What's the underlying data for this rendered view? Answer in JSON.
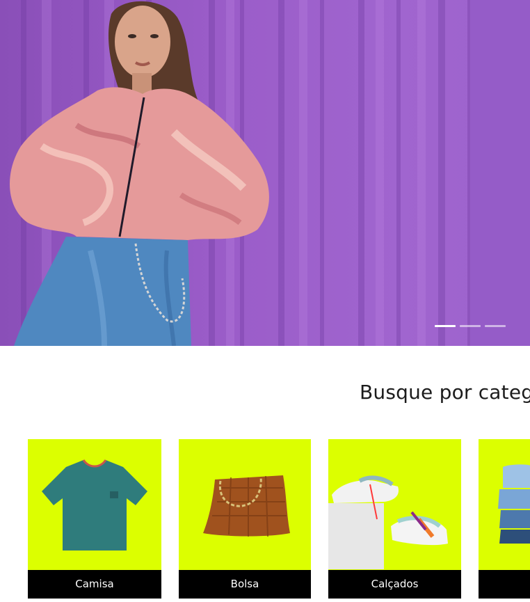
{
  "hero": {
    "slides_total": 3,
    "active_slide": 1
  },
  "section": {
    "title": "Busque por categ"
  },
  "categories": [
    {
      "label": "Camisa",
      "icon": "tshirt-image"
    },
    {
      "label": "Bolsa",
      "icon": "handbag-image"
    },
    {
      "label": "Calçados",
      "icon": "sneakers-image"
    },
    {
      "label": "",
      "icon": "jeans-stack-image"
    }
  ],
  "colors": {
    "hero_bg": "#9a5cc8",
    "category_bg": "#dcff00",
    "label_bg": "#000000",
    "label_text": "#ffffff"
  }
}
